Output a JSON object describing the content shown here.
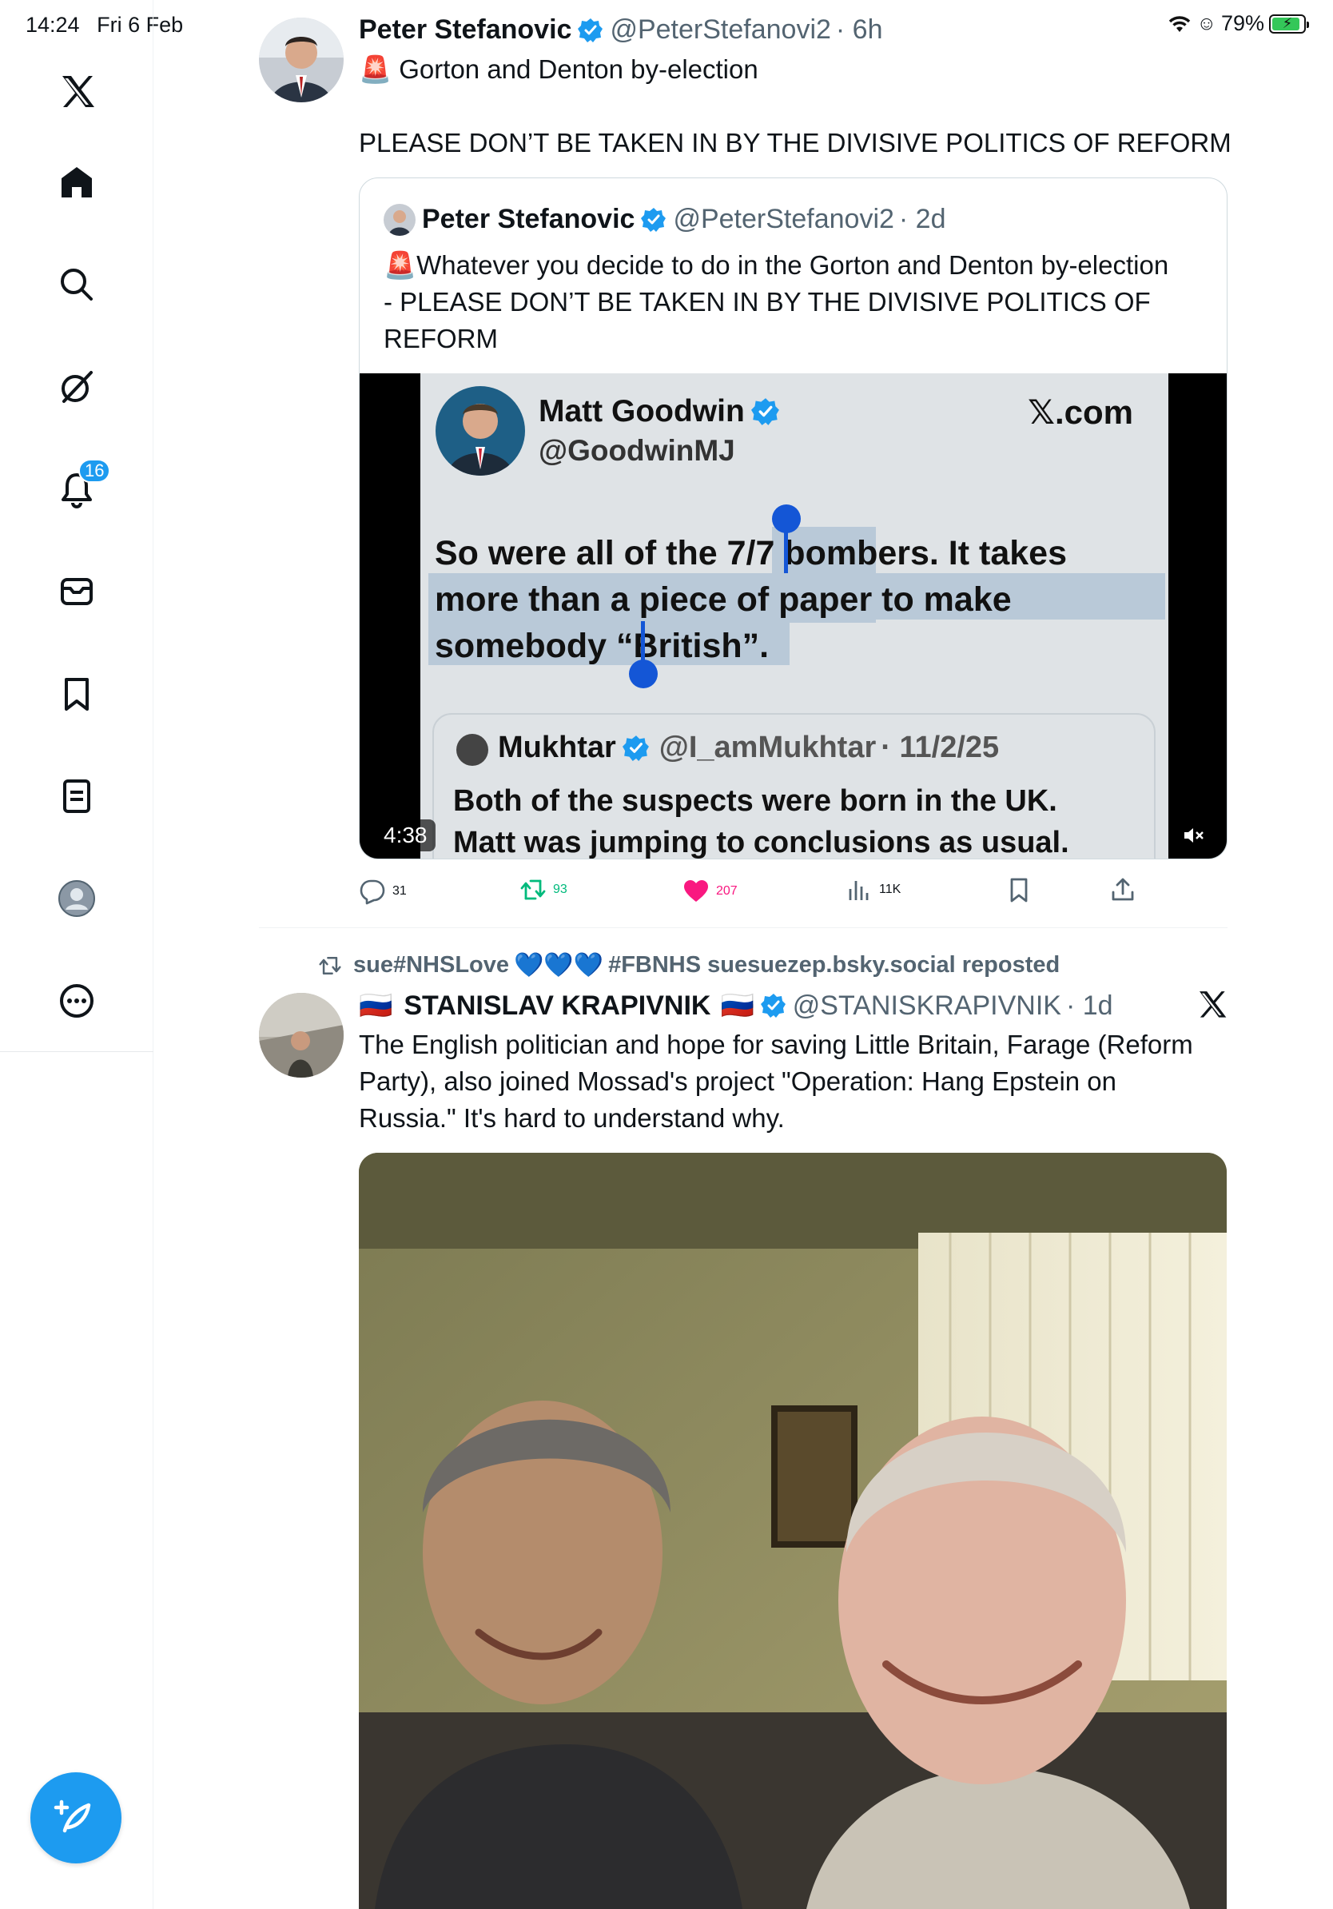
{
  "status_bar": {
    "time": "14:24",
    "date": "Fri 6 Feb",
    "battery_percent": "79%",
    "battery_level": 0.79
  },
  "sidebar": {
    "notifications_count": "16",
    "items": [
      "x-logo-icon",
      "home-icon",
      "search-icon",
      "grok-icon",
      "notifications-icon",
      "messages-icon",
      "bookmarks-icon",
      "lists-icon",
      "profile-icon",
      "more-icon"
    ]
  },
  "tweet1": {
    "author_name": "Peter Stefanovic",
    "handle": "@PeterStefanovi2",
    "time": "· 6h",
    "line1_emoji": "🚨",
    "line1": "Gorton and Denton by-election",
    "line2": "PLEASE DON’T BE TAKEN IN BY THE DIVISIVE POLITICS OF REFORM",
    "quote": {
      "author_name": "Peter Stefanovic",
      "handle": "@PeterStefanovi2",
      "time": "· 2d",
      "text_emoji": "🚨",
      "text_l1": "Whatever you decide to do in the Gorton and Denton by-election",
      "text_l2": "-  PLEASE DON’T BE TAKEN IN BY THE DIVISIVE POLITICS OF",
      "text_l3": "REFORM",
      "video": {
        "duration": "4:38",
        "inner_name": "Matt Goodwin",
        "inner_handle": "@GoodwinMJ",
        "inner_brand": "𝕏.com",
        "inner_text_l1a": "So were all of the 7/7 bombers. ",
        "inner_text_l1b": "It takes",
        "inner_text_l2": "more than a piece of paper to make",
        "inner_text_l3": "somebody “British”.",
        "nested_name": "Mukhtar",
        "nested_handle": "@I_amMukhtar",
        "nested_time": "· 11/2/25",
        "nested_l1": "Both of the suspects were born in the UK.",
        "nested_l2": "Matt was jumping to conclusions as usual."
      }
    },
    "stats": {
      "replies": "31",
      "reposts": "93",
      "likes": "207",
      "views": "11K"
    }
  },
  "tweet2": {
    "repost_by": "sue#NHSLove",
    "repost_hearts": "💙💙💙",
    "repost_suffix": "#FBNHS suesuezep.bsky.social reposted",
    "author_flag": "🇷🇺",
    "author_name": "STANISLAV KRAPIVNIK",
    "handle": "@STANISKRAPIVNIK",
    "time": "· 1d",
    "text_l1": "The English politician and hope for saving Little Britain, Farage (Reform",
    "text_l2": "Party), also joined Mossad's project \"Operation: Hang Epstein on",
    "text_l3": "Russia.\" It's hard to understand why."
  },
  "colors": {
    "accent": "#1d9bf0",
    "like": "#f91880",
    "repost": "#00ba7c",
    "text_secondary": "#536471"
  }
}
